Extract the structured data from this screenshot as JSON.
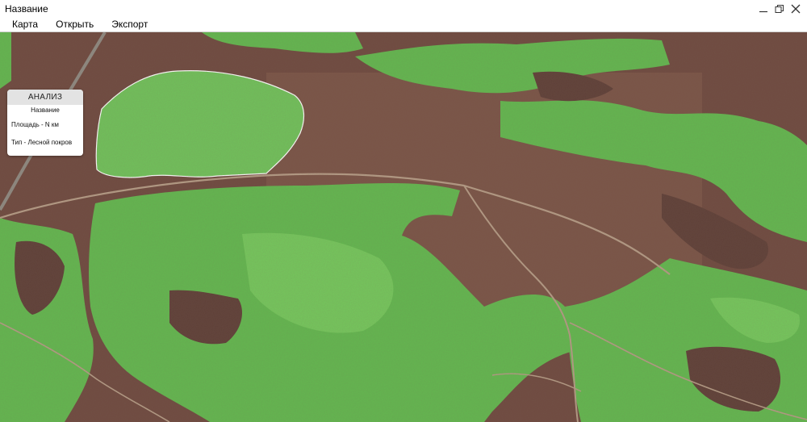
{
  "window": {
    "title": "Название",
    "controls": [
      {
        "name": "minimize-icon",
        "glyph": "minimize"
      },
      {
        "name": "restore-icon",
        "glyph": "restore"
      },
      {
        "name": "close-icon",
        "glyph": "close"
      }
    ]
  },
  "menu": {
    "items": [
      "Карта",
      "Открыть",
      "Экспорт"
    ]
  },
  "analysis_panel": {
    "header": "АНАЛИЗ",
    "name": "Название",
    "area": "Площадь - N км",
    "type": "Тип - Лесной покров"
  },
  "map": {
    "layer": "forest-cover-overlay",
    "colors": {
      "bare_ground": "#6f4a40",
      "forest": "#62b94f",
      "forest_light": "#74c95c",
      "road": "#b59c86",
      "selection_outline": "#ffffff"
    }
  }
}
